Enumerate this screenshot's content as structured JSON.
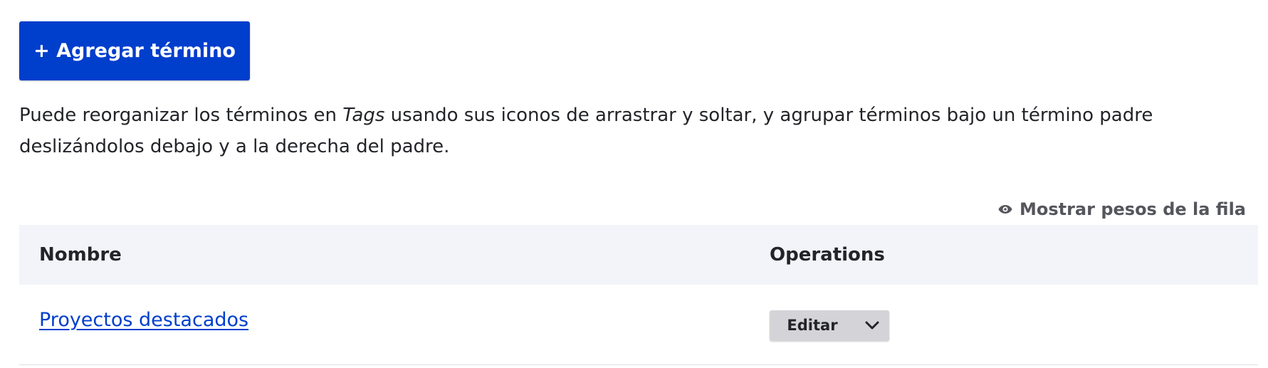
{
  "actions": {
    "add_term_label": "+ Agregar término"
  },
  "help": {
    "before": "Puede reorganizar los términos en ",
    "vocabulary": "Tags",
    "after": " usando sus iconos de arrastrar y soltar, y agrupar términos bajo un término padre deslizándolos debajo y a la derecha del padre."
  },
  "table": {
    "show_weights_label": "Mostrar pesos de la fila",
    "show_weights_icon": "eye-icon",
    "headers": {
      "name": "Nombre",
      "operations": "Operations"
    },
    "rows": [
      {
        "name": "Proyectos destacados",
        "operation_label": "Editar",
        "toggle_icon": "chevron-down-icon"
      }
    ]
  },
  "colors": {
    "primary": "#003ecc",
    "header_bg": "#f3f4f9",
    "dropbutton_bg": "#d4d4d8"
  }
}
